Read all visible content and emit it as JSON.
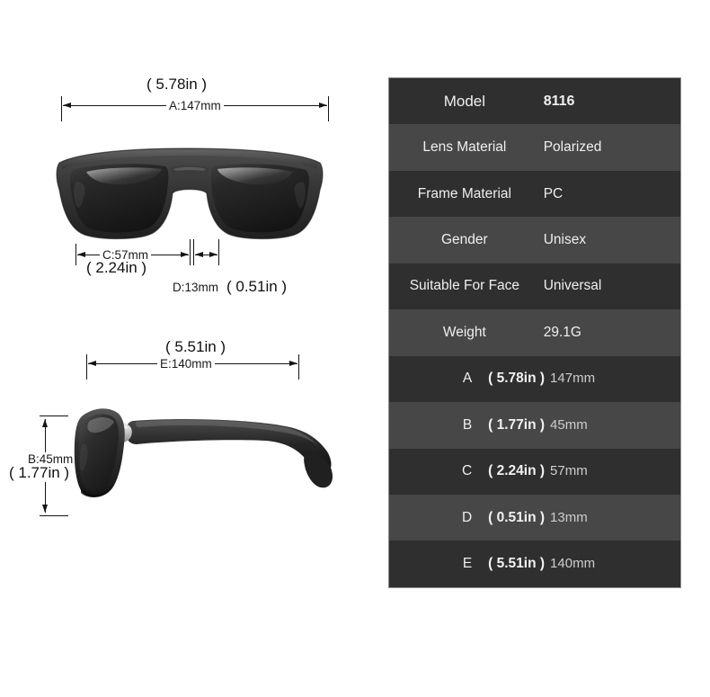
{
  "product": {
    "front_view_alt": "sunglasses-front-view",
    "side_view_alt": "sunglasses-side-view"
  },
  "dimensions": {
    "A": {
      "letter": "A",
      "mm_label": "A:147mm",
      "inch_label": "( 5.78in )",
      "mm_value": "147mm",
      "inch_value": "( 5.78in )"
    },
    "B": {
      "letter": "B",
      "mm_label": "B:45mm",
      "inch_label": "( 1.77in )",
      "mm_value": "45mm",
      "inch_value": "( 1.77in )"
    },
    "C": {
      "letter": "C",
      "mm_label": "C:57mm",
      "inch_label": "( 2.24in )",
      "mm_value": "57mm",
      "inch_value": "( 2.24in )"
    },
    "D": {
      "letter": "D",
      "mm_label": "D:13mm",
      "inch_label": "( 0.51in )",
      "mm_value": "13mm",
      "inch_value": "( 0.51in )"
    },
    "E": {
      "letter": "E",
      "mm_label": "E:140mm",
      "inch_label": "( 5.51in )",
      "mm_value": "140mm",
      "inch_value": "( 5.51in )"
    }
  },
  "spec_table": {
    "rows": [
      {
        "label": "Model",
        "value": "8116"
      },
      {
        "label": "Lens Material",
        "value": "Polarized"
      },
      {
        "label": "Frame Material",
        "value": "PC"
      },
      {
        "label": "Gender",
        "value": "Unisex"
      },
      {
        "label": "Suitable For Face",
        "value": "Universal"
      },
      {
        "label": "Weight",
        "value": "29.1G"
      }
    ],
    "dimension_rows": [
      {
        "letter": "A",
        "inch": "( 5.78in )",
        "mm": "147mm"
      },
      {
        "letter": "B",
        "inch": "( 1.77in )",
        "mm": "45mm"
      },
      {
        "letter": "C",
        "inch": "( 2.24in )",
        "mm": "57mm"
      },
      {
        "letter": "D",
        "inch": "( 0.51in )",
        "mm": "13mm"
      },
      {
        "letter": "E",
        "inch": "( 5.51in )",
        "mm": "140mm"
      }
    ]
  },
  "colors": {
    "row_dark": "#2f2f2f",
    "row_light": "#474747",
    "table_border": "#8d8d8d",
    "text": "#efefef",
    "mm_text": "#cdcdcd",
    "line": "#141414",
    "background": "#ffffff"
  }
}
